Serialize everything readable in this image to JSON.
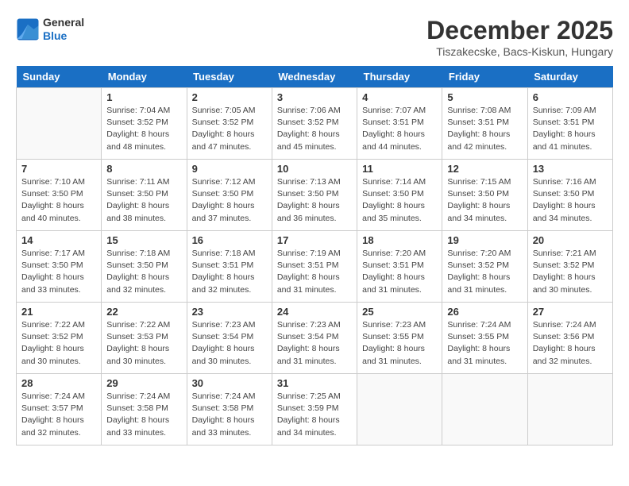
{
  "header": {
    "logo_general": "General",
    "logo_blue": "Blue",
    "month_title": "December 2025",
    "location": "Tiszakecske, Bacs-Kiskun, Hungary"
  },
  "days_of_week": [
    "Sunday",
    "Monday",
    "Tuesday",
    "Wednesday",
    "Thursday",
    "Friday",
    "Saturday"
  ],
  "weeks": [
    [
      {
        "day": "",
        "info": ""
      },
      {
        "day": "1",
        "info": "Sunrise: 7:04 AM\nSunset: 3:52 PM\nDaylight: 8 hours\nand 48 minutes."
      },
      {
        "day": "2",
        "info": "Sunrise: 7:05 AM\nSunset: 3:52 PM\nDaylight: 8 hours\nand 47 minutes."
      },
      {
        "day": "3",
        "info": "Sunrise: 7:06 AM\nSunset: 3:52 PM\nDaylight: 8 hours\nand 45 minutes."
      },
      {
        "day": "4",
        "info": "Sunrise: 7:07 AM\nSunset: 3:51 PM\nDaylight: 8 hours\nand 44 minutes."
      },
      {
        "day": "5",
        "info": "Sunrise: 7:08 AM\nSunset: 3:51 PM\nDaylight: 8 hours\nand 42 minutes."
      },
      {
        "day": "6",
        "info": "Sunrise: 7:09 AM\nSunset: 3:51 PM\nDaylight: 8 hours\nand 41 minutes."
      }
    ],
    [
      {
        "day": "7",
        "info": "Sunrise: 7:10 AM\nSunset: 3:50 PM\nDaylight: 8 hours\nand 40 minutes."
      },
      {
        "day": "8",
        "info": "Sunrise: 7:11 AM\nSunset: 3:50 PM\nDaylight: 8 hours\nand 38 minutes."
      },
      {
        "day": "9",
        "info": "Sunrise: 7:12 AM\nSunset: 3:50 PM\nDaylight: 8 hours\nand 37 minutes."
      },
      {
        "day": "10",
        "info": "Sunrise: 7:13 AM\nSunset: 3:50 PM\nDaylight: 8 hours\nand 36 minutes."
      },
      {
        "day": "11",
        "info": "Sunrise: 7:14 AM\nSunset: 3:50 PM\nDaylight: 8 hours\nand 35 minutes."
      },
      {
        "day": "12",
        "info": "Sunrise: 7:15 AM\nSunset: 3:50 PM\nDaylight: 8 hours\nand 34 minutes."
      },
      {
        "day": "13",
        "info": "Sunrise: 7:16 AM\nSunset: 3:50 PM\nDaylight: 8 hours\nand 34 minutes."
      }
    ],
    [
      {
        "day": "14",
        "info": "Sunrise: 7:17 AM\nSunset: 3:50 PM\nDaylight: 8 hours\nand 33 minutes."
      },
      {
        "day": "15",
        "info": "Sunrise: 7:18 AM\nSunset: 3:50 PM\nDaylight: 8 hours\nand 32 minutes."
      },
      {
        "day": "16",
        "info": "Sunrise: 7:18 AM\nSunset: 3:51 PM\nDaylight: 8 hours\nand 32 minutes."
      },
      {
        "day": "17",
        "info": "Sunrise: 7:19 AM\nSunset: 3:51 PM\nDaylight: 8 hours\nand 31 minutes."
      },
      {
        "day": "18",
        "info": "Sunrise: 7:20 AM\nSunset: 3:51 PM\nDaylight: 8 hours\nand 31 minutes."
      },
      {
        "day": "19",
        "info": "Sunrise: 7:20 AM\nSunset: 3:52 PM\nDaylight: 8 hours\nand 31 minutes."
      },
      {
        "day": "20",
        "info": "Sunrise: 7:21 AM\nSunset: 3:52 PM\nDaylight: 8 hours\nand 30 minutes."
      }
    ],
    [
      {
        "day": "21",
        "info": "Sunrise: 7:22 AM\nSunset: 3:52 PM\nDaylight: 8 hours\nand 30 minutes."
      },
      {
        "day": "22",
        "info": "Sunrise: 7:22 AM\nSunset: 3:53 PM\nDaylight: 8 hours\nand 30 minutes."
      },
      {
        "day": "23",
        "info": "Sunrise: 7:23 AM\nSunset: 3:54 PM\nDaylight: 8 hours\nand 30 minutes."
      },
      {
        "day": "24",
        "info": "Sunrise: 7:23 AM\nSunset: 3:54 PM\nDaylight: 8 hours\nand 31 minutes."
      },
      {
        "day": "25",
        "info": "Sunrise: 7:23 AM\nSunset: 3:55 PM\nDaylight: 8 hours\nand 31 minutes."
      },
      {
        "day": "26",
        "info": "Sunrise: 7:24 AM\nSunset: 3:55 PM\nDaylight: 8 hours\nand 31 minutes."
      },
      {
        "day": "27",
        "info": "Sunrise: 7:24 AM\nSunset: 3:56 PM\nDaylight: 8 hours\nand 32 minutes."
      }
    ],
    [
      {
        "day": "28",
        "info": "Sunrise: 7:24 AM\nSunset: 3:57 PM\nDaylight: 8 hours\nand 32 minutes."
      },
      {
        "day": "29",
        "info": "Sunrise: 7:24 AM\nSunset: 3:58 PM\nDaylight: 8 hours\nand 33 minutes."
      },
      {
        "day": "30",
        "info": "Sunrise: 7:24 AM\nSunset: 3:58 PM\nDaylight: 8 hours\nand 33 minutes."
      },
      {
        "day": "31",
        "info": "Sunrise: 7:25 AM\nSunset: 3:59 PM\nDaylight: 8 hours\nand 34 minutes."
      },
      {
        "day": "",
        "info": ""
      },
      {
        "day": "",
        "info": ""
      },
      {
        "day": "",
        "info": ""
      }
    ]
  ]
}
